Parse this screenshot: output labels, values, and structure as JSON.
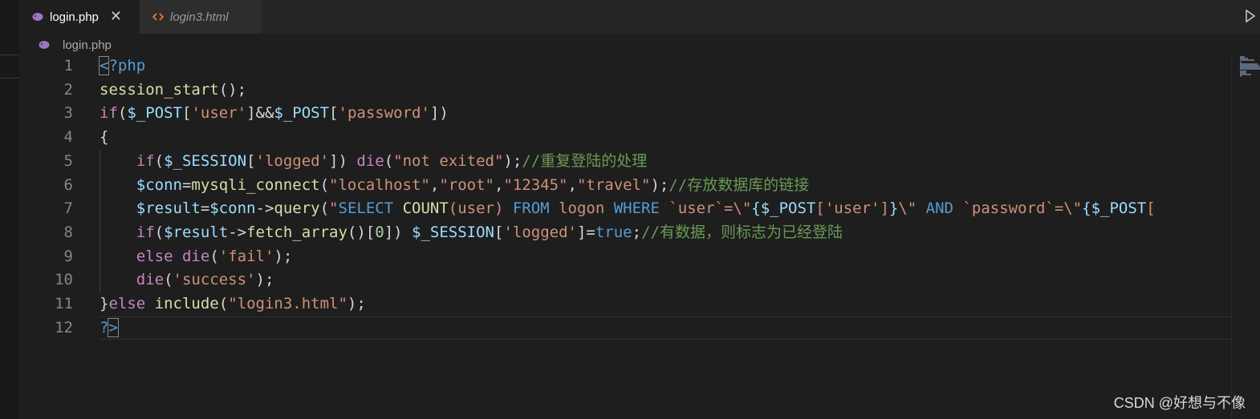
{
  "tabs": [
    {
      "label": "login.php",
      "icon": "php-elephant-icon",
      "active": true,
      "close": "✕"
    },
    {
      "label": "login3.html",
      "icon": "html-brackets-icon",
      "active": false
    }
  ],
  "breadcrumb": {
    "label": "login.php",
    "icon": "php-elephant-icon"
  },
  "editor": {
    "lines": [
      {
        "n": "1",
        "tokens": [
          [
            "t-tag",
            "<"
          ],
          [
            "t-tag",
            "?php"
          ]
        ]
      },
      {
        "n": "2",
        "tokens": [
          [
            "t-fn",
            "session_start"
          ],
          [
            "t-punc",
            "();"
          ]
        ]
      },
      {
        "n": "3",
        "tokens": [
          [
            "t-kw",
            "if"
          ],
          [
            "t-punc",
            "("
          ],
          [
            "t-var",
            "$_POST"
          ],
          [
            "t-punc",
            "["
          ],
          [
            "t-str",
            "'user'"
          ],
          [
            "t-punc",
            "]&&"
          ],
          [
            "t-var",
            "$_POST"
          ],
          [
            "t-punc",
            "["
          ],
          [
            "t-str",
            "'password'"
          ],
          [
            "t-punc",
            "])"
          ]
        ]
      },
      {
        "n": "4",
        "tokens": [
          [
            "t-punc",
            "{"
          ]
        ]
      },
      {
        "n": "5",
        "tokens": [
          [
            "t-plain",
            "    "
          ],
          [
            "t-kw",
            "if"
          ],
          [
            "t-punc",
            "("
          ],
          [
            "t-var",
            "$_SESSION"
          ],
          [
            "t-punc",
            "["
          ],
          [
            "t-str",
            "'logged'"
          ],
          [
            "t-punc",
            "]) "
          ],
          [
            "t-kw",
            "die"
          ],
          [
            "t-punc",
            "("
          ],
          [
            "t-str",
            "\"not exited\""
          ],
          [
            "t-punc",
            ");"
          ],
          [
            "t-cm",
            "//重复登陆的处理"
          ]
        ]
      },
      {
        "n": "6",
        "tokens": [
          [
            "t-plain",
            "    "
          ],
          [
            "t-var",
            "$conn"
          ],
          [
            "t-punc",
            "="
          ],
          [
            "t-fn",
            "mysqli_connect"
          ],
          [
            "t-punc",
            "("
          ],
          [
            "t-str",
            "\"localhost\""
          ],
          [
            "t-punc",
            ","
          ],
          [
            "t-str",
            "\"root\""
          ],
          [
            "t-punc",
            ","
          ],
          [
            "t-str",
            "\"12345\""
          ],
          [
            "t-punc",
            ","
          ],
          [
            "t-str",
            "\"travel\""
          ],
          [
            "t-punc",
            ");"
          ],
          [
            "t-cm",
            "//存放数据库的链接"
          ]
        ]
      },
      {
        "n": "7",
        "tokens": [
          [
            "t-plain",
            "    "
          ],
          [
            "t-var",
            "$result"
          ],
          [
            "t-punc",
            "="
          ],
          [
            "t-var",
            "$conn"
          ],
          [
            "t-punc",
            "->"
          ],
          [
            "t-fn",
            "query"
          ],
          [
            "t-punc",
            "("
          ],
          [
            "t-str",
            "\""
          ],
          [
            "t-sql",
            "SELECT "
          ],
          [
            "t-fn",
            "COUNT"
          ],
          [
            "t-str",
            "(user) "
          ],
          [
            "t-sql",
            "FROM "
          ],
          [
            "t-str",
            "logon "
          ],
          [
            "t-sql",
            "WHERE "
          ],
          [
            "t-str",
            "`user`=\\\""
          ],
          [
            "t-var",
            "{$_POST"
          ],
          [
            "t-str",
            "['user']"
          ],
          [
            "t-var",
            "}"
          ],
          [
            "t-str",
            "\\\" "
          ],
          [
            "t-sql",
            "AND "
          ],
          [
            "t-str",
            "`password`=\\\""
          ],
          [
            "t-var",
            "{$_POST"
          ],
          [
            "t-str",
            "["
          ]
        ]
      },
      {
        "n": "8",
        "tokens": [
          [
            "t-plain",
            "    "
          ],
          [
            "t-kw",
            "if"
          ],
          [
            "t-punc",
            "("
          ],
          [
            "t-var",
            "$result"
          ],
          [
            "t-punc",
            "->"
          ],
          [
            "t-fn",
            "fetch_array"
          ],
          [
            "t-punc",
            "()["
          ],
          [
            "t-num",
            "0"
          ],
          [
            "t-punc",
            "]) "
          ],
          [
            "t-var",
            "$_SESSION"
          ],
          [
            "t-punc",
            "["
          ],
          [
            "t-str",
            "'logged'"
          ],
          [
            "t-punc",
            "]="
          ],
          [
            "t-sql",
            "true"
          ],
          [
            "t-punc",
            ";"
          ],
          [
            "t-cm",
            "//有数据，则标志为已经登陆"
          ]
        ]
      },
      {
        "n": "9",
        "tokens": [
          [
            "t-plain",
            "    "
          ],
          [
            "t-kw",
            "else"
          ],
          [
            "t-plain",
            " "
          ],
          [
            "t-kw",
            "die"
          ],
          [
            "t-punc",
            "("
          ],
          [
            "t-str",
            "'fail'"
          ],
          [
            "t-punc",
            ");"
          ]
        ]
      },
      {
        "n": "10",
        "tokens": [
          [
            "t-plain",
            "    "
          ],
          [
            "t-kw",
            "die"
          ],
          [
            "t-punc",
            "("
          ],
          [
            "t-str",
            "'success'"
          ],
          [
            "t-punc",
            ");"
          ]
        ]
      },
      {
        "n": "11",
        "tokens": [
          [
            "t-punc",
            "}"
          ],
          [
            "t-kw",
            "else"
          ],
          [
            "t-plain",
            " "
          ],
          [
            "t-fn",
            "include"
          ],
          [
            "t-punc",
            "("
          ],
          [
            "t-str",
            "\"login3.html\""
          ],
          [
            "t-punc",
            ");"
          ]
        ]
      },
      {
        "n": "12",
        "tokens": [
          [
            "t-tag",
            "?"
          ],
          [
            "t-tag",
            ">"
          ]
        ]
      }
    ]
  },
  "watermark": "CSDN @好想与不像",
  "colors": {
    "background": "#1e1e1e",
    "tabbar": "#252526",
    "keyword": "#c586c0",
    "string": "#ce9178",
    "variable": "#9cdcfe",
    "function": "#dcdcaa",
    "comment": "#6a9955",
    "tag": "#569cd6"
  }
}
